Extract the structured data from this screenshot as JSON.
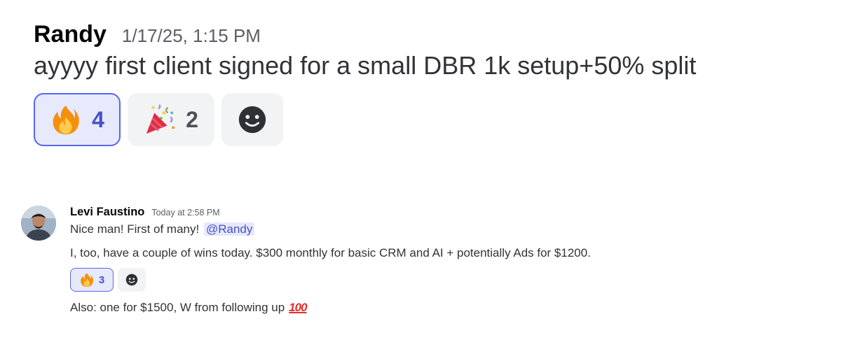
{
  "message1": {
    "author": "Randy",
    "timestamp": "1/17/25, 1:15 PM",
    "content": "ayyyy first client signed for a small DBR 1k setup+50% split",
    "reactions": [
      {
        "emoji": "fire-icon",
        "count": "4",
        "selected": true
      },
      {
        "emoji": "party-popper-icon",
        "count": "2",
        "selected": false
      },
      {
        "emoji": "add-reaction-icon",
        "count": "",
        "selected": false
      }
    ]
  },
  "message2": {
    "author": "Levi Faustino",
    "timestamp": "Today at 2:58 PM",
    "line1_text": "Nice man! First of many!",
    "mention": "@Randy",
    "line2_text": "I, too, have a couple of wins today. $300 monthly for basic CRM and AI + potentially Ads for $1200.",
    "reactions": [
      {
        "emoji": "fire-icon",
        "count": "3",
        "selected": true
      },
      {
        "emoji": "add-reaction-icon",
        "count": "",
        "selected": false
      }
    ],
    "line3_text": "Also: one for $1500, W from following up",
    "line3_emoji": "hundred-points-icon",
    "line3_emoji_glyph": "100"
  },
  "colors": {
    "accent": "#5865f2",
    "selected_reaction_bg": "#e7e9fd",
    "reaction_bg": "#f2f3f5",
    "hundred_red": "#e02f2f"
  }
}
